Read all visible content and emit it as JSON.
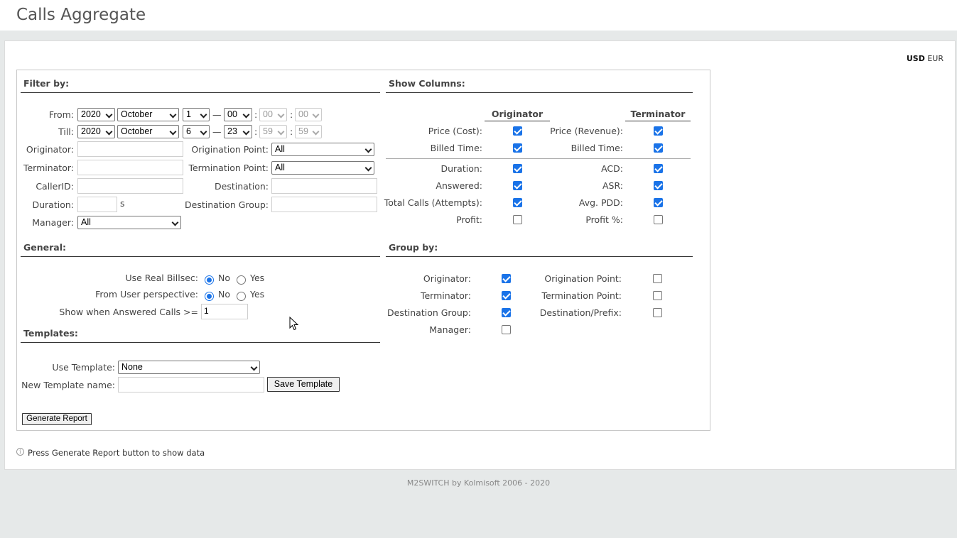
{
  "page": {
    "title": "Calls Aggregate"
  },
  "currency": {
    "primary": "USD",
    "secondary": "EUR"
  },
  "filter": {
    "title": "Filter by:",
    "from_label": "From:",
    "till_label": "Till:",
    "from": {
      "year": "2020",
      "month": "October",
      "day": "1",
      "hour": "00",
      "minute": "00",
      "second": "00"
    },
    "till": {
      "year": "2020",
      "month": "October",
      "day": "6",
      "hour": "23",
      "minute": "59",
      "second": "59"
    },
    "dash": "—",
    "colon": ":",
    "originator_label": "Originator:",
    "terminator_label": "Terminator:",
    "callerid_label": "CallerID:",
    "duration_label": "Duration:",
    "duration_unit": "s",
    "manager_label": "Manager:",
    "manager_value": "All",
    "orig_point_label": "Origination Point:",
    "orig_point_value": "All",
    "term_point_label": "Termination Point:",
    "term_point_value": "All",
    "destination_label": "Destination:",
    "dest_group_label": "Destination Group:"
  },
  "general": {
    "title": "General:",
    "real_billsec_label": "Use Real Billsec:",
    "user_perspective_label": "From User perspective:",
    "no_label": "No",
    "yes_label": "Yes",
    "answered_label": "Show when Answered Calls >=",
    "answered_value": "1"
  },
  "templates": {
    "title": "Templates:",
    "use_label": "Use Template:",
    "use_value": "None",
    "new_label": "New Template name:",
    "save_button": "Save Template"
  },
  "generate_button": "Generate Report",
  "show_columns": {
    "title": "Show Columns:",
    "originator_head": "Originator",
    "terminator_head": "Terminator",
    "price_cost": "Price (Cost):",
    "billed_time": "Billed Time:",
    "duration": "Duration:",
    "answered": "Answered:",
    "total_calls": "Total Calls (Attempts):",
    "profit": "Profit:",
    "price_revenue": "Price (Revenue):",
    "billed_time_t": "Billed Time:",
    "acd": "ACD:",
    "asr": "ASR:",
    "avg_pdd": "Avg. PDD:",
    "profit_pct": "Profit %:"
  },
  "group_by": {
    "title": "Group by:",
    "originator": "Originator:",
    "terminator": "Terminator:",
    "destination_group": "Destination Group:",
    "manager": "Manager:",
    "origination_point": "Origination Point:",
    "termination_point": "Termination Point:",
    "destination_prefix": "Destination/Prefix:"
  },
  "info_text": "Press Generate Report button to show data",
  "footer": "M2SWITCH by Kolmisoft 2006 - 2020"
}
